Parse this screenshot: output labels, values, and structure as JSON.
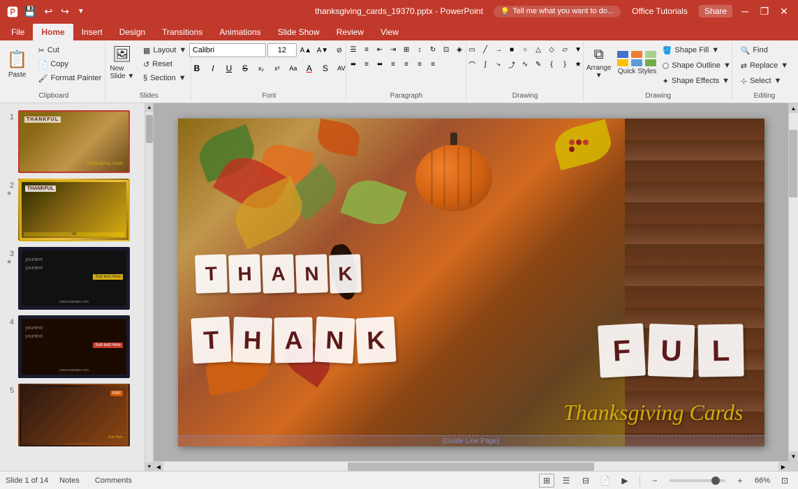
{
  "titleBar": {
    "title": "thanksgiving_cards_19370.pptx - PowerPoint",
    "quickAccess": {
      "save": "💾",
      "undo": "↩",
      "redo": "↪",
      "customize": "🔧"
    },
    "windowControls": {
      "minimize": "─",
      "restore": "❐",
      "close": "✕"
    }
  },
  "ribbon": {
    "tabs": [
      "File",
      "Home",
      "Insert",
      "Design",
      "Transitions",
      "Animations",
      "Slide Show",
      "Review",
      "View"
    ],
    "activeTab": "Home",
    "groups": {
      "clipboard": {
        "label": "Clipboard",
        "paste": "Paste",
        "cut": "Cut",
        "copy": "Copy",
        "formatPainter": "Format Painter"
      },
      "slides": {
        "label": "Slides",
        "newSlide": "New Slide",
        "layout": "Layout",
        "reset": "Reset",
        "section": "Section"
      },
      "font": {
        "label": "Font",
        "fontName": "Calibri",
        "fontSize": "12",
        "bold": "B",
        "italic": "I",
        "underline": "U",
        "strikethrough": "S",
        "fontColor": "A"
      },
      "paragraph": {
        "label": "Paragraph"
      },
      "drawing": {
        "label": "Drawing"
      },
      "arrange": {
        "label": "Arrange",
        "arrangeBtn": "Arrange"
      },
      "quickStyles": {
        "label": "Quick Styles",
        "text": "Quick Styles"
      },
      "shapeOptions": {
        "shapeFill": "Shape Fill",
        "shapeOutline": "Shape Outline",
        "shapeEffects": "Shape Effects"
      },
      "editing": {
        "label": "Editing",
        "find": "Find",
        "replace": "Replace",
        "select": "Select"
      }
    },
    "tellMe": "Tell me what you want to do...",
    "officeTutorials": "Office Tutorials",
    "share": "Share"
  },
  "slidePanel": {
    "slides": [
      {
        "num": "1",
        "label": "Slide 1",
        "active": true
      },
      {
        "num": "2",
        "label": "Slide 2",
        "active": false,
        "star": true
      },
      {
        "num": "3",
        "label": "Slide 3",
        "active": false,
        "star": true
      },
      {
        "num": "4",
        "label": "Slide 4",
        "active": false
      },
      {
        "num": "5",
        "label": "Slide 5",
        "active": false
      }
    ]
  },
  "mainSlide": {
    "thankfulTop": [
      "T",
      "H",
      "A",
      "N",
      "K"
    ],
    "thankfulBottom": [
      "F",
      "U",
      "L"
    ],
    "titleText": "Thanksgiving Cards",
    "guideText": "{Guide Line Page}"
  },
  "statusBar": {
    "slideInfo": "Slide 1 of 14",
    "notes": "Notes",
    "comments": "Comments",
    "zoom": "66%",
    "views": [
      "normal",
      "outline",
      "slide-sorter",
      "reading",
      "presenter"
    ]
  }
}
